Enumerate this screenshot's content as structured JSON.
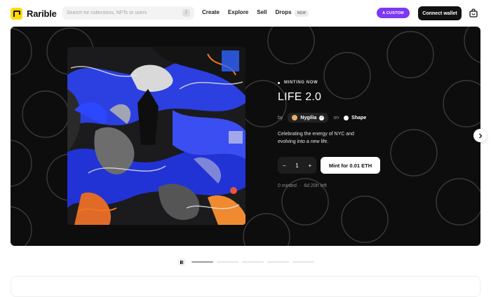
{
  "brand": {
    "name": "Rarible",
    "accent": "#feda03"
  },
  "search": {
    "placeholder": "Search for collections, NFTs or users",
    "shortcut": "/"
  },
  "nav": {
    "items": [
      "Create",
      "Explore",
      "Sell",
      "Drops"
    ],
    "new_badge": "NEW"
  },
  "header": {
    "custom_label": "A CUSTOM",
    "connect_label": "Connect wallet",
    "custom_color": "#7d38f2"
  },
  "hero": {
    "status": "MINTING NOW",
    "title": "LIFE 2.0",
    "by_label": "by",
    "creator": "Nygilia",
    "on_label": "on",
    "chain": "Shape",
    "description": "Celebrating the energy of NYC and evolving into a new life.",
    "quantity": "1",
    "decrement": "−",
    "increment": "+",
    "mint_label": "Mint for 0.01 ETH",
    "minted": "0 minted",
    "separator": "·",
    "time_left": "6d 20h left"
  },
  "carousel": {
    "slides": 5,
    "active_index": 0,
    "active_progress": 1.0
  },
  "icons": {
    "cart": "shopping-bag-icon",
    "next": "chevron-right-icon",
    "pause": "pause-icon",
    "verified": "verified-check-icon"
  }
}
